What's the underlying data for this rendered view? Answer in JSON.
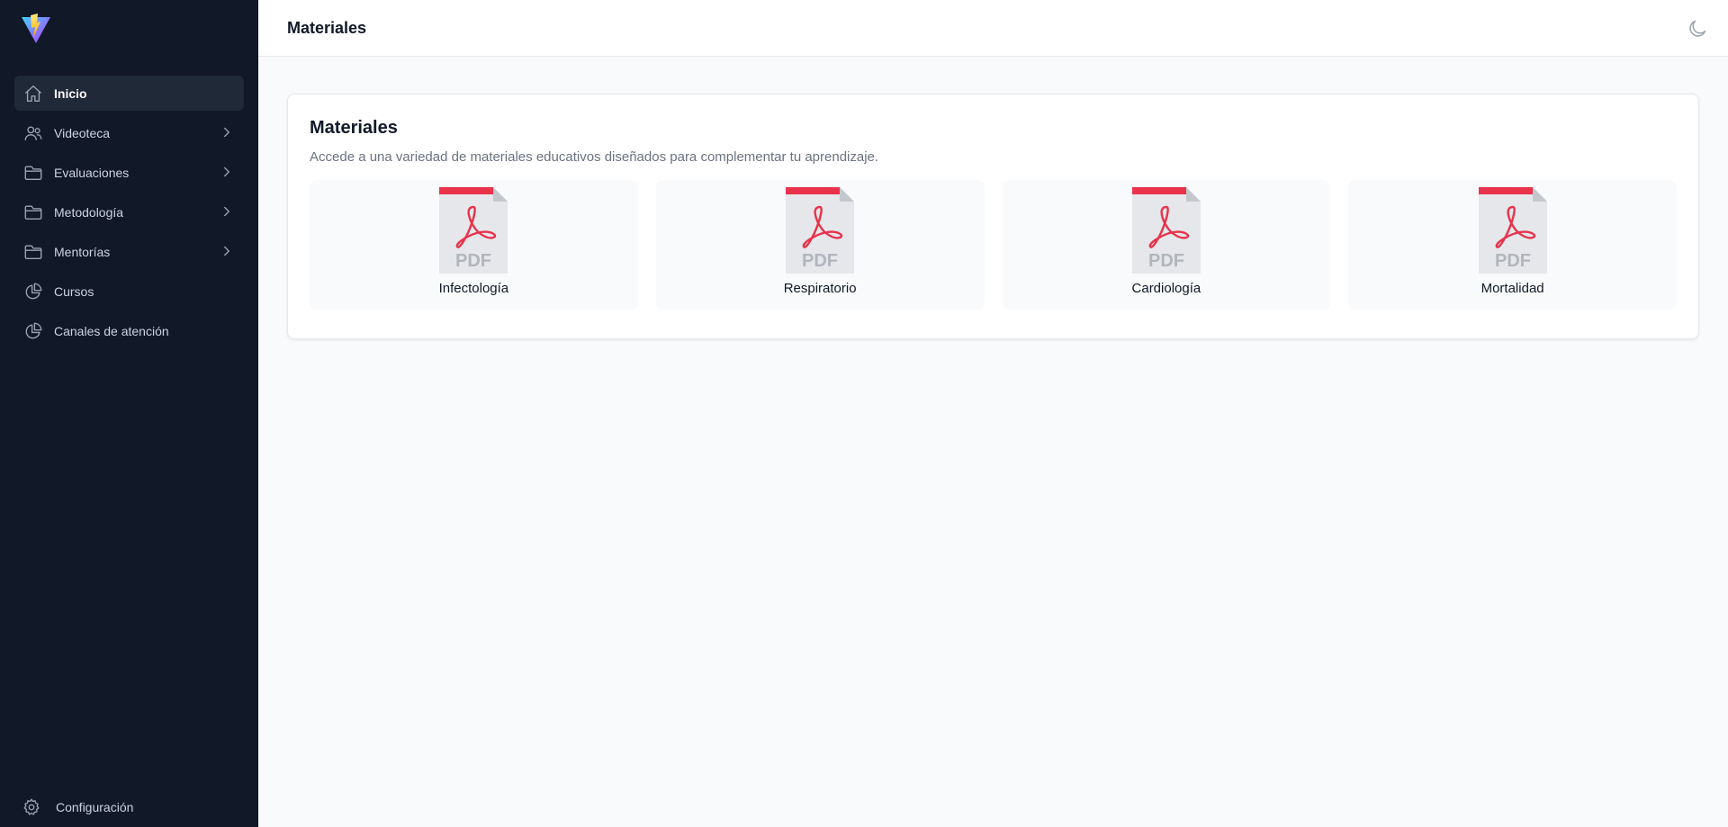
{
  "sidebar": {
    "items": [
      {
        "label": "Inicio",
        "icon": "home-icon",
        "active": true,
        "chevron": false
      },
      {
        "label": "Videoteca",
        "icon": "users-icon",
        "active": false,
        "chevron": true
      },
      {
        "label": "Evaluaciones",
        "icon": "folder-icon",
        "active": false,
        "chevron": true
      },
      {
        "label": "Metodología",
        "icon": "folder-icon",
        "active": false,
        "chevron": true
      },
      {
        "label": "Mentorías",
        "icon": "folder-icon",
        "active": false,
        "chevron": true
      },
      {
        "label": "Cursos",
        "icon": "pie-chart-icon",
        "active": false,
        "chevron": false
      },
      {
        "label": "Canales de atención",
        "icon": "pie-chart-icon",
        "active": false,
        "chevron": false
      }
    ],
    "settings_label": "Configuración"
  },
  "header": {
    "title": "Materiales"
  },
  "main": {
    "title": "Materiales",
    "description": "Accede a una variedad de materiales educativos diseñados para complementar tu aprendizaje.",
    "materials": [
      {
        "label": "Infectología",
        "icon": "pdf-file-icon"
      },
      {
        "label": "Respiratorio",
        "icon": "pdf-file-icon"
      },
      {
        "label": "Cardiología",
        "icon": "pdf-file-icon"
      },
      {
        "label": "Mortalidad",
        "icon": "pdf-file-icon"
      }
    ],
    "pdf_badge": "PDF"
  },
  "colors": {
    "sidebar_bg": "#111827",
    "active_item_bg": "#1f2937",
    "pdf_red": "#e8334a"
  }
}
